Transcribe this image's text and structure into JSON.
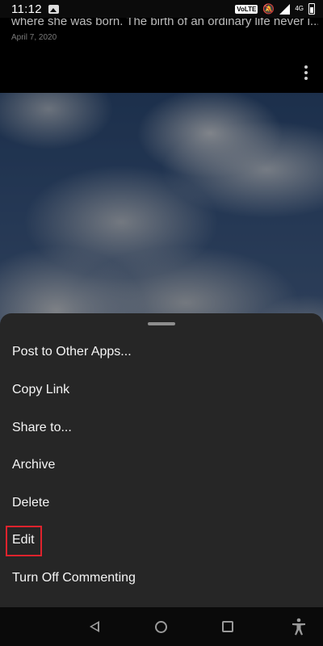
{
  "status_bar": {
    "time": "11:12",
    "volte": "VoLTE",
    "network": "4G"
  },
  "post": {
    "caption": "where she was born. The birth of an ordinary life never i...",
    "more_label": " more",
    "date": "April 7, 2020"
  },
  "menu": {
    "items": [
      {
        "label": "Post to Other Apps..."
      },
      {
        "label": "Copy Link"
      },
      {
        "label": "Share to..."
      },
      {
        "label": "Archive"
      },
      {
        "label": "Delete"
      },
      {
        "label": "Edit"
      },
      {
        "label": "Turn Off Commenting"
      }
    ]
  },
  "colors": {
    "sheet_background": "#262626",
    "highlight": "#e0232d"
  }
}
